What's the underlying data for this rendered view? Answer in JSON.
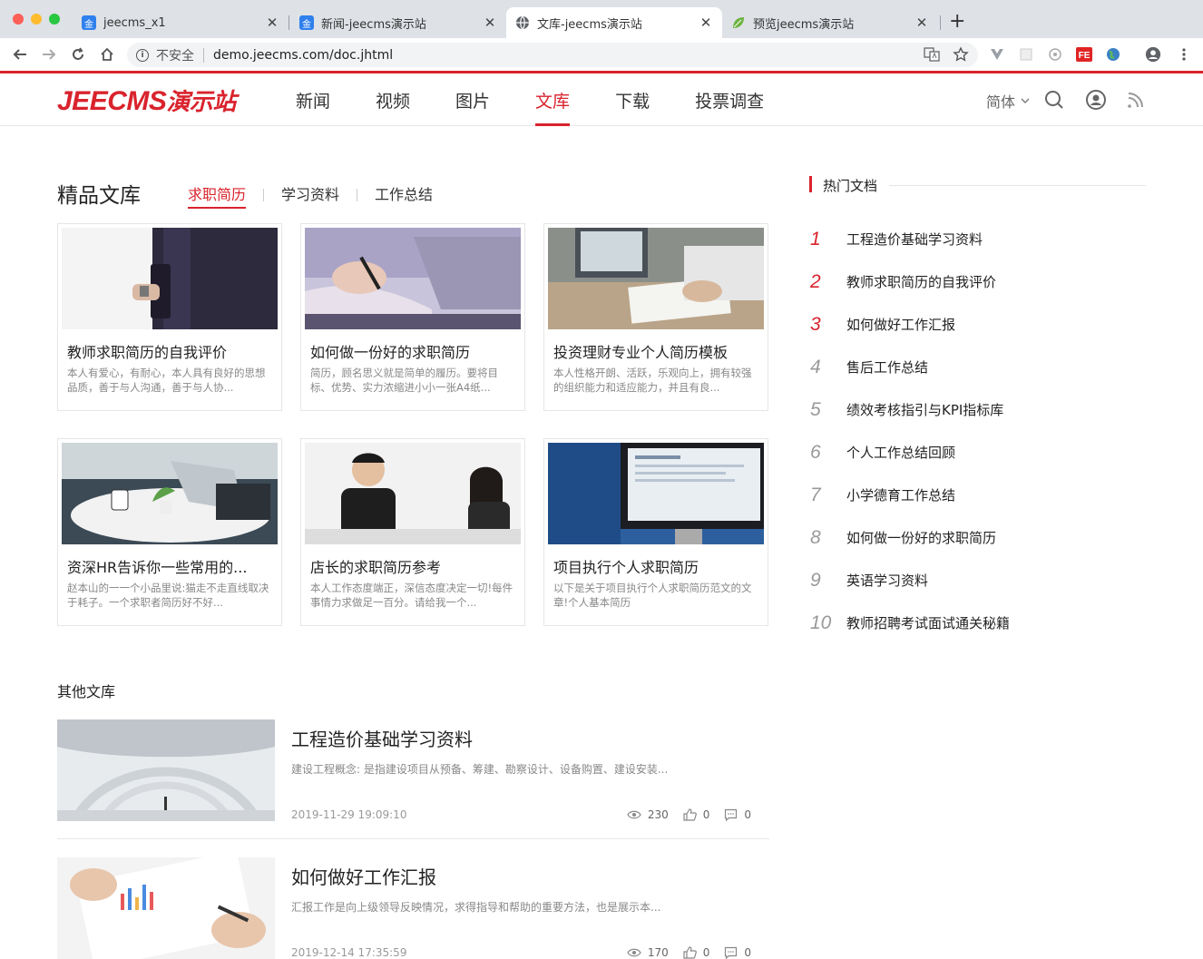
{
  "browser": {
    "tabs": [
      {
        "title": "jeecms_x1",
        "icon": "jin-icon"
      },
      {
        "title": "新闻-jeecms演示站",
        "icon": "jin-icon"
      },
      {
        "title": "文库-jeecms演示站",
        "icon": "globe-icon",
        "active": true
      },
      {
        "title": "预览jeecms演示站",
        "icon": "leaf-icon"
      }
    ],
    "tab_close": "✕",
    "new_tab": "+",
    "fav_char": "金",
    "insecure_label": "不安全",
    "url": "demo.jeecms.com/doc.jhtml"
  },
  "site": {
    "logo_latin": "JEECMS",
    "logo_cn": "演示站",
    "nav": [
      "新闻",
      "视频",
      "图片",
      "文库",
      "下载",
      "投票调查"
    ],
    "active_nav": "文库",
    "lang": "简体",
    "accent": "#d9232d"
  },
  "main": {
    "section_title": "精品文库",
    "subtabs": [
      "求职简历",
      "学习资料",
      "工作总结"
    ],
    "cards": [
      {
        "title": "教师求职简历的自我评价",
        "desc": "本人有爱心，有耐心，本人具有良好的思想品质，善于与人沟通，善于与人协..."
      },
      {
        "title": "如何做一份好的求职简历",
        "desc": "简历，顾名思义就是简单的履历。要将目标、优势、实力浓缩进小小一张A4纸..."
      },
      {
        "title": "投资理财专业个人简历模板",
        "desc": "本人性格开朗、活跃，乐观向上，拥有较强的组织能力和适应能力，并且有良..."
      },
      {
        "title": "资深HR告诉你一些常用的...",
        "desc": "赵本山的一一个小品里说:猫走不走直线取决于耗子。一个求职者简历好不好..."
      },
      {
        "title": "店长的求职简历参考",
        "desc": "本人工作态度端正，深信态度决定一切!每件事情力求做足一百分。请给我一个..."
      },
      {
        "title": "项目执行个人求职简历",
        "desc": "以下是关于项目执行个人求职简历范文的文章!个人基本简历"
      }
    ],
    "other_title": "其他文库",
    "list": [
      {
        "title": "工程造价基础学习资料",
        "desc": "建设工程概念: 是指建设项目从预备、筹建、勘察设计、设备购置、建设安装...",
        "date": "2019-11-29 19:09:10",
        "views": "230",
        "likes": "0",
        "comments": "0"
      },
      {
        "title": "如何做好工作汇报",
        "desc": "汇报工作是向上级领导反映情况，求得指导和帮助的重要方法，也是展示本...",
        "date": "2019-12-14 17:35:59",
        "views": "170",
        "likes": "0",
        "comments": "0"
      }
    ]
  },
  "sidebar": {
    "title": "热门文档",
    "items": [
      {
        "num": "1",
        "title": "工程造价基础学习资料"
      },
      {
        "num": "2",
        "title": "教师求职简历的自我评价"
      },
      {
        "num": "3",
        "title": "如何做好工作汇报"
      },
      {
        "num": "4",
        "title": "售后工作总结"
      },
      {
        "num": "5",
        "title": "绩效考核指引与KPI指标库"
      },
      {
        "num": "6",
        "title": "个人工作总结回顾"
      },
      {
        "num": "7",
        "title": "小学德育工作总结"
      },
      {
        "num": "8",
        "title": "如何做一份好的求职简历"
      },
      {
        "num": "9",
        "title": "英语学习资料"
      },
      {
        "num": "10",
        "title": "教师招聘考试面试通关秘籍"
      }
    ]
  }
}
